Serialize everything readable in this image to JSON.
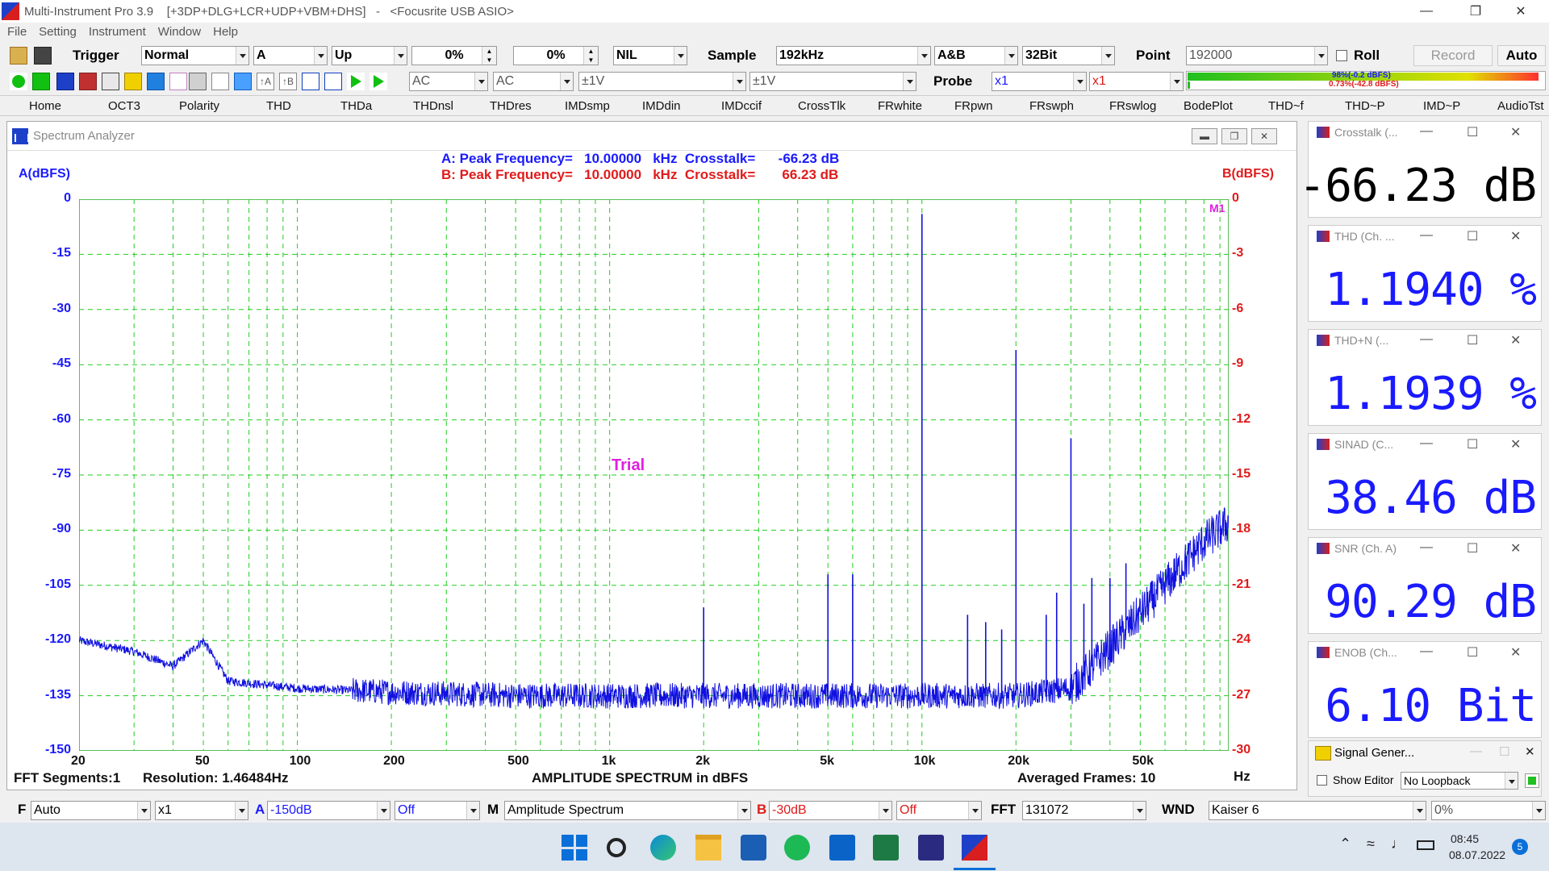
{
  "window": {
    "title": "Multi-Instrument Pro 3.9    [+3DP+DLG+LCR+UDP+VBM+DHS]   -   <Focusrite USB ASIO>"
  },
  "menu": [
    "File",
    "Setting",
    "Instrument",
    "Window",
    "Help"
  ],
  "toolbar1": {
    "trigger_label": "Trigger",
    "trigger_mode": "Normal",
    "trigger_channel": "A",
    "trigger_edge": "Up",
    "pretrigger": "0%",
    "level": "0%",
    "nil": "NIL",
    "sample_label": "Sample",
    "sample_rate": "192kHz",
    "channels": "A&B",
    "bits": "32Bit",
    "point_label": "Point",
    "points": "192000",
    "roll_label": "Roll",
    "record_label": "Record",
    "auto_label": "Auto"
  },
  "toolbar2": {
    "coupling_a": "AC",
    "coupling_b": "AC",
    "range_a": "±1V",
    "range_b": "±1V",
    "probe_label": "Probe",
    "probe_a": "x1",
    "probe_b": "x1",
    "level_a": "98%(-0.2 dBFS)",
    "level_b": "0.73%(-42.8 dBFS)",
    "level_a_fill": 0.98,
    "level_b_fill": 0.0073
  },
  "nav": [
    "Home",
    "OCT3",
    "Polarity",
    "THD",
    "THDa",
    "THDnsl",
    "THDres",
    "IMDsmp",
    "IMDdin",
    "IMDccif",
    "CrossTlk",
    "FRwhite",
    "FRpwn",
    "FRswph",
    "FRswlog",
    "BodePlot",
    "THD~f",
    "THD~P",
    "IMD~P",
    "AudioTst"
  ],
  "spectrum": {
    "window_title": "Spectrum Analyzer",
    "readout_a": "A: Peak Frequency=   10.00000   kHz  Crosstalk=      -66.23 dB",
    "readout_b": "B: Peak Frequency=   10.00000   kHz  Crosstalk=       66.23 dB",
    "axis_a_label": "A(dBFS)",
    "axis_b_label": "B(dBFS)",
    "watermark": "Trial",
    "marker": "M1",
    "fft_segments": "FFT Segments:1",
    "resolution": "Resolution: 1.46484Hz",
    "plot_title": "AMPLITUDE SPECTRUM in dBFS",
    "averaged": "Averaged Frames: 10",
    "hz_label": "Hz"
  },
  "chart_data": {
    "type": "line",
    "title": "AMPLITUDE SPECTRUM in dBFS",
    "xlabel": "Hz",
    "ylabel": "A(dBFS)",
    "y2label": "B(dBFS)",
    "x_scale": "log",
    "xlim": [
      20,
      96000
    ],
    "ylim": [
      -150,
      0
    ],
    "y2lim": [
      -30,
      0
    ],
    "grid": true,
    "x_ticks": [
      "20",
      "50",
      "100",
      "200",
      "500",
      "1k",
      "2k",
      "5k",
      "10k",
      "20k",
      "50k"
    ],
    "x_tick_values": [
      20,
      50,
      100,
      200,
      500,
      1000,
      2000,
      5000,
      10000,
      20000,
      50000
    ],
    "y_ticks": [
      "0",
      "-15",
      "-30",
      "-45",
      "-60",
      "-75",
      "-90",
      "-105",
      "-120",
      "-135",
      "-150"
    ],
    "y2_ticks": [
      "0",
      "-3",
      "-6",
      "-9",
      "-12",
      "-15",
      "-18",
      "-21",
      "-24",
      "-27",
      "-30"
    ],
    "series": [
      {
        "color": "#1010e0",
        "noise_floor": [
          [
            20,
            -120
          ],
          [
            30,
            -123
          ],
          [
            40,
            -127
          ],
          [
            50,
            -120
          ],
          [
            60,
            -131
          ],
          [
            100,
            -133
          ],
          [
            200,
            -134
          ],
          [
            500,
            -135
          ],
          [
            1000,
            -135
          ],
          [
            5000,
            -135
          ],
          [
            20000,
            -135
          ],
          [
            30000,
            -133
          ],
          [
            40000,
            -122
          ],
          [
            60000,
            -105
          ],
          [
            80000,
            -93
          ],
          [
            96000,
            -88
          ]
        ],
        "peaks": [
          [
            2000,
            -111
          ],
          [
            5000,
            -102
          ],
          [
            6000,
            -102
          ],
          [
            10000,
            -4
          ],
          [
            14000,
            -113
          ],
          [
            16000,
            -115
          ],
          [
            18000,
            -117
          ],
          [
            20000,
            -41
          ],
          [
            25000,
            -113
          ],
          [
            27000,
            -107
          ],
          [
            30000,
            -65
          ],
          [
            33000,
            -110
          ],
          [
            35000,
            -103
          ],
          [
            40000,
            -103
          ],
          [
            45000,
            -99
          ]
        ]
      }
    ]
  },
  "panels": [
    {
      "title": "Crosstalk (...",
      "value": "-66.23 dB",
      "color": "#000000"
    },
    {
      "title": "THD (Ch. ...",
      "value": "1.1940 %",
      "color": "#1a1aff"
    },
    {
      "title": "THD+N (...",
      "value": "1.1939 %",
      "color": "#1a1aff"
    },
    {
      "title": "SINAD (C...",
      "value": "38.46 dB",
      "color": "#1a1aff"
    },
    {
      "title": "SNR (Ch. A)",
      "value": "90.29 dB",
      "color": "#1a1aff"
    },
    {
      "title": "ENOB (Ch...",
      "value": "6.10 Bit",
      "color": "#1a1aff"
    }
  ],
  "siggen": {
    "title": "Signal Gener...",
    "show_editor": "Show Editor",
    "loopback": "No Loopback"
  },
  "bottombar": {
    "f_label": "F",
    "f_value": "Auto",
    "mult": "x1",
    "a_label": "A",
    "a_value": "-150dB",
    "a_off": "Off",
    "m_label": "M",
    "m_value": "Amplitude Spectrum",
    "b_label": "B",
    "b_value": "-30dB",
    "b_off": "Off",
    "fft_label": "FFT",
    "fft_value": "131072",
    "wnd_label": "WND",
    "wnd_value": "Kaiser 6",
    "pct": "0%"
  },
  "taskbar": {
    "time": "08:45",
    "date": "08.07.2022",
    "badge": "5"
  }
}
